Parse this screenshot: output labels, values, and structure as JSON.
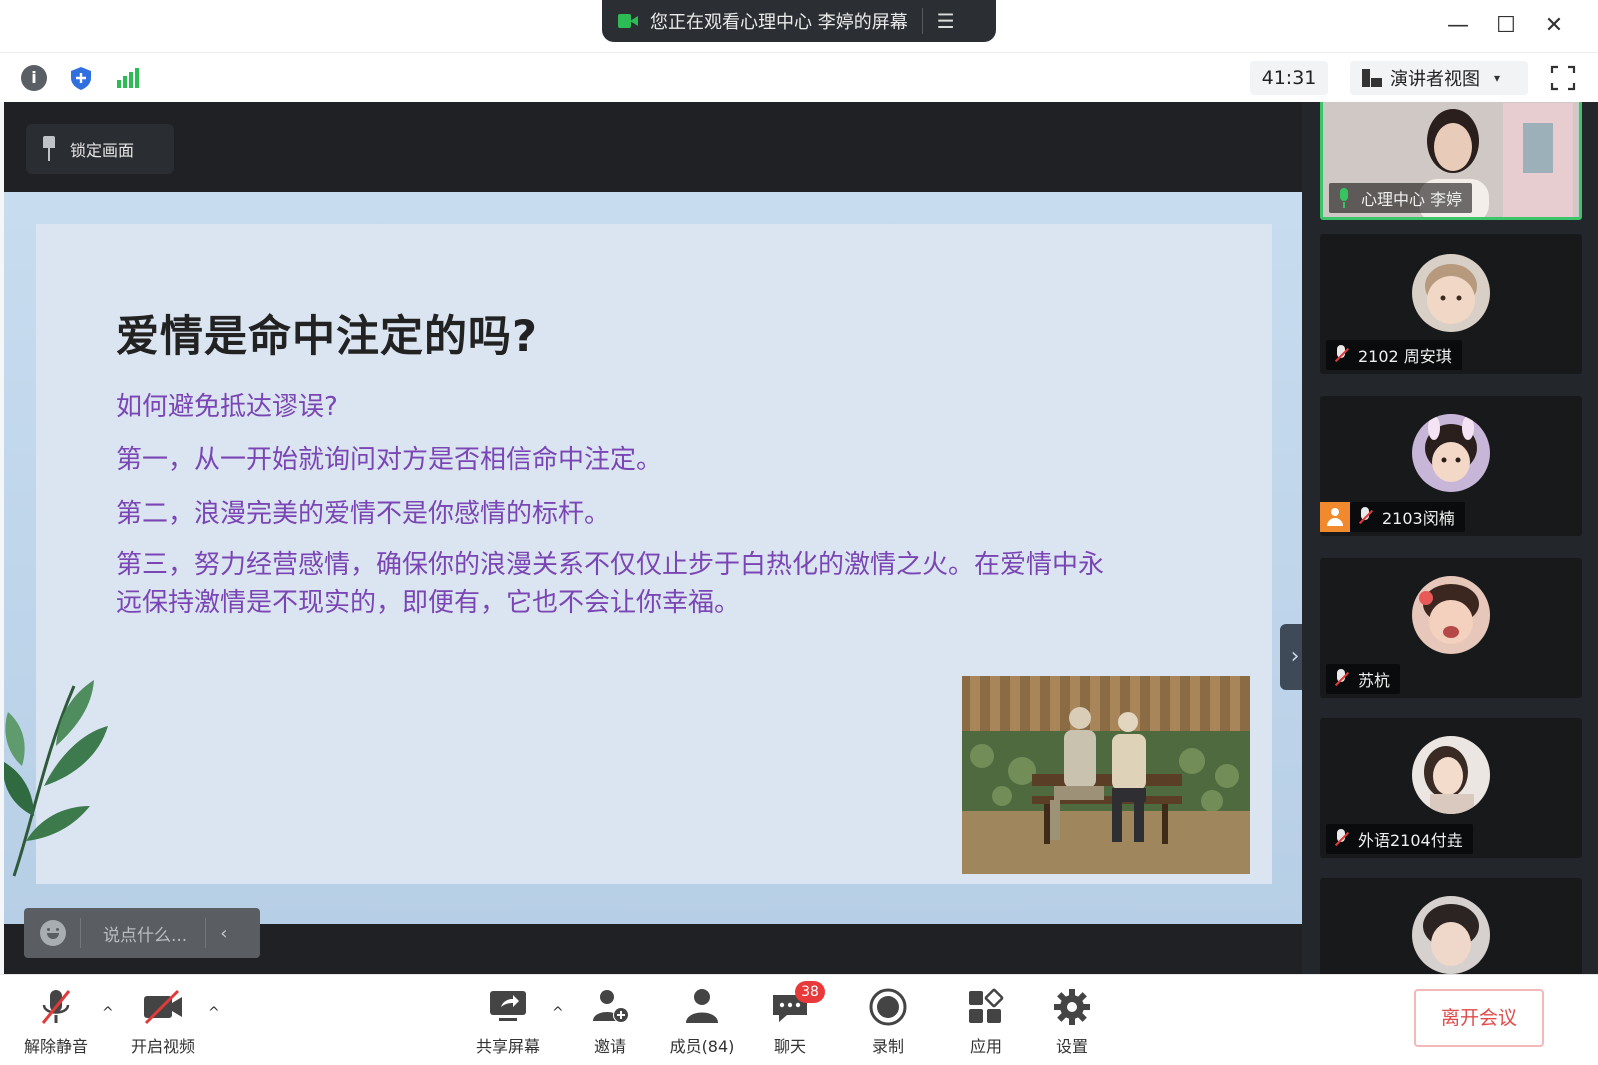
{
  "window": {
    "share_banner": "您正在观看心理中心 李婷的屏幕",
    "menu_glyph": "☰",
    "minimize_glyph": "—",
    "maximize_glyph": "☐",
    "close_glyph": "✕"
  },
  "infobar": {
    "info_glyph": "i",
    "timer": "41:31",
    "view_mode": "演讲者视图",
    "view_caret": "▾"
  },
  "stage": {
    "lock_label": "锁定画面",
    "chat_placeholder": "说点什么...",
    "chat_back_glyph": "‹",
    "collapse_glyph": "›"
  },
  "slide": {
    "title": "爱情是命中注定的吗?",
    "lines": [
      "如何避免抵达谬误?",
      "第一，从一开始就询问对方是否相信命中注定。",
      "第二，浪漫完美的爱情不是你感情的标杆。",
      "第三，努力经营感情，确保你的浪漫关系不仅仅止步于白热化的激情之火。在爱情中永远保持激情是不现实的，即便有，它也不会让你幸福。"
    ]
  },
  "participants": [
    {
      "name": "心理中心 李婷",
      "mic": "on",
      "active": true
    },
    {
      "name": "2102 周安琪",
      "mic": "off",
      "active": false
    },
    {
      "name": "2103闵楠",
      "mic": "off",
      "active": false,
      "host_badge": true
    },
    {
      "name": "苏杭",
      "mic": "off",
      "active": false
    },
    {
      "name": "外语2104付垚",
      "mic": "off",
      "active": false
    },
    {
      "name": "",
      "mic": "off",
      "active": false
    }
  ],
  "toolbar": {
    "unmute": "解除静音",
    "start_video": "开启视频",
    "share_screen": "共享屏幕",
    "invite": "邀请",
    "members": "成员(84)",
    "chat": "聊天",
    "chat_badge": "38",
    "record": "录制",
    "apps": "应用",
    "settings": "设置",
    "leave": "离开会议",
    "caret_glyph": "^"
  },
  "colors": {
    "accent_green": "#3cc46a",
    "slide_body_purple": "#7a45b4",
    "leave_red": "#e04b4b"
  }
}
